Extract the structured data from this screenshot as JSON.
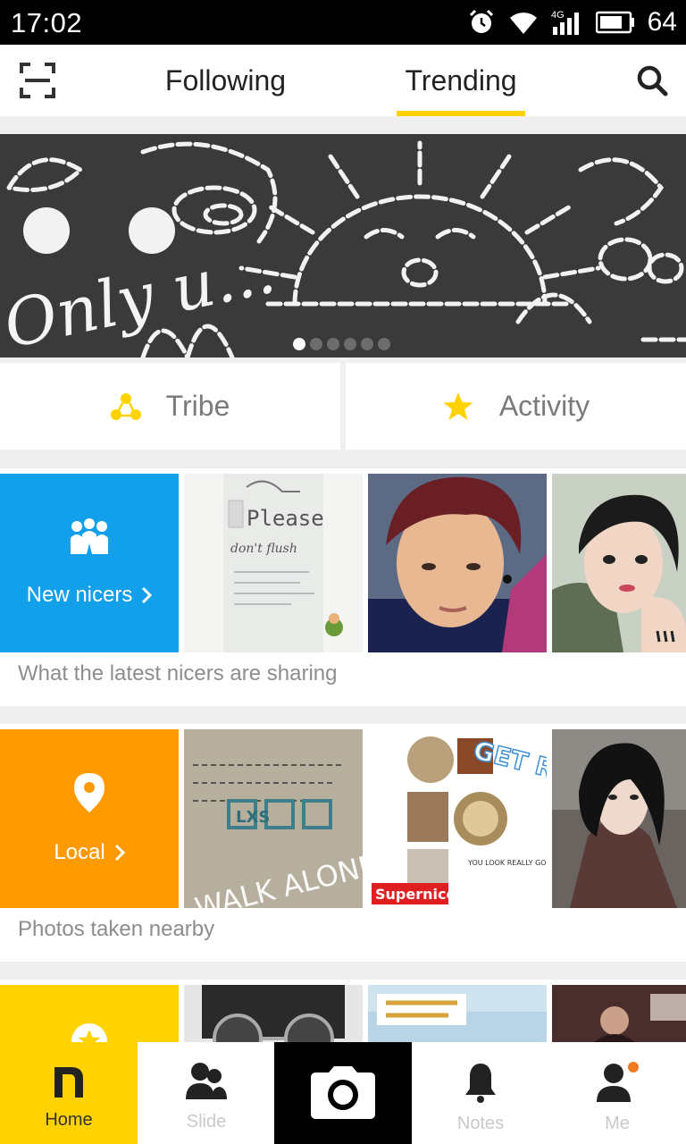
{
  "status_bar": {
    "time": "17:02",
    "battery_level": "64",
    "network": "4G",
    "icons": [
      "alarm-icon",
      "wifi-icon",
      "signal-icon",
      "battery-icon"
    ]
  },
  "top_nav": {
    "tabs": [
      {
        "label": "Following",
        "active": false
      },
      {
        "label": "Trending",
        "active": true
      }
    ],
    "accent_color": "#ffd200",
    "icons": [
      "scan-icon",
      "search-icon"
    ]
  },
  "banner": {
    "slide_count": 6,
    "active_slide": 1,
    "banner_text": "Only u..."
  },
  "quick_actions": [
    {
      "label": "Tribe",
      "icon": "tribe-icon",
      "icon_color": "#ffd200"
    },
    {
      "label": "Activity",
      "icon": "star-icon",
      "icon_color": "#ffd200"
    }
  ],
  "sections": {
    "new_nicers": {
      "tile_label": "New nicers",
      "tile_icon": "people-icon",
      "tile_color": "#13a0ea",
      "caption": "What the latest nicers are sharing",
      "thumb_text": [
        "Please",
        "don't flush"
      ]
    },
    "local": {
      "tile_label": "Local",
      "tile_icon": "location-pin-icon",
      "tile_color": "#ff9a00",
      "caption": "Photos taken nearby",
      "thumb_text": [
        "WALK ALONE",
        "LXS",
        "GET READY",
        "Supernice",
        "YOU LOOK REALLY GOOD TODAY"
      ]
    },
    "third": {
      "tile_color": "#ffd200",
      "tile_icon": "star-icon"
    }
  },
  "bottom_nav": {
    "items": [
      {
        "label": "Home",
        "icon": "home-n-icon",
        "active": true
      },
      {
        "label": "Slide",
        "icon": "people-icon",
        "active": false
      },
      {
        "label": "",
        "icon": "camera-icon",
        "active": false
      },
      {
        "label": "Notes",
        "icon": "bell-icon",
        "active": false
      },
      {
        "label": "Me",
        "icon": "person-icon",
        "active": false,
        "badge_color": "#f07b22"
      }
    ]
  }
}
